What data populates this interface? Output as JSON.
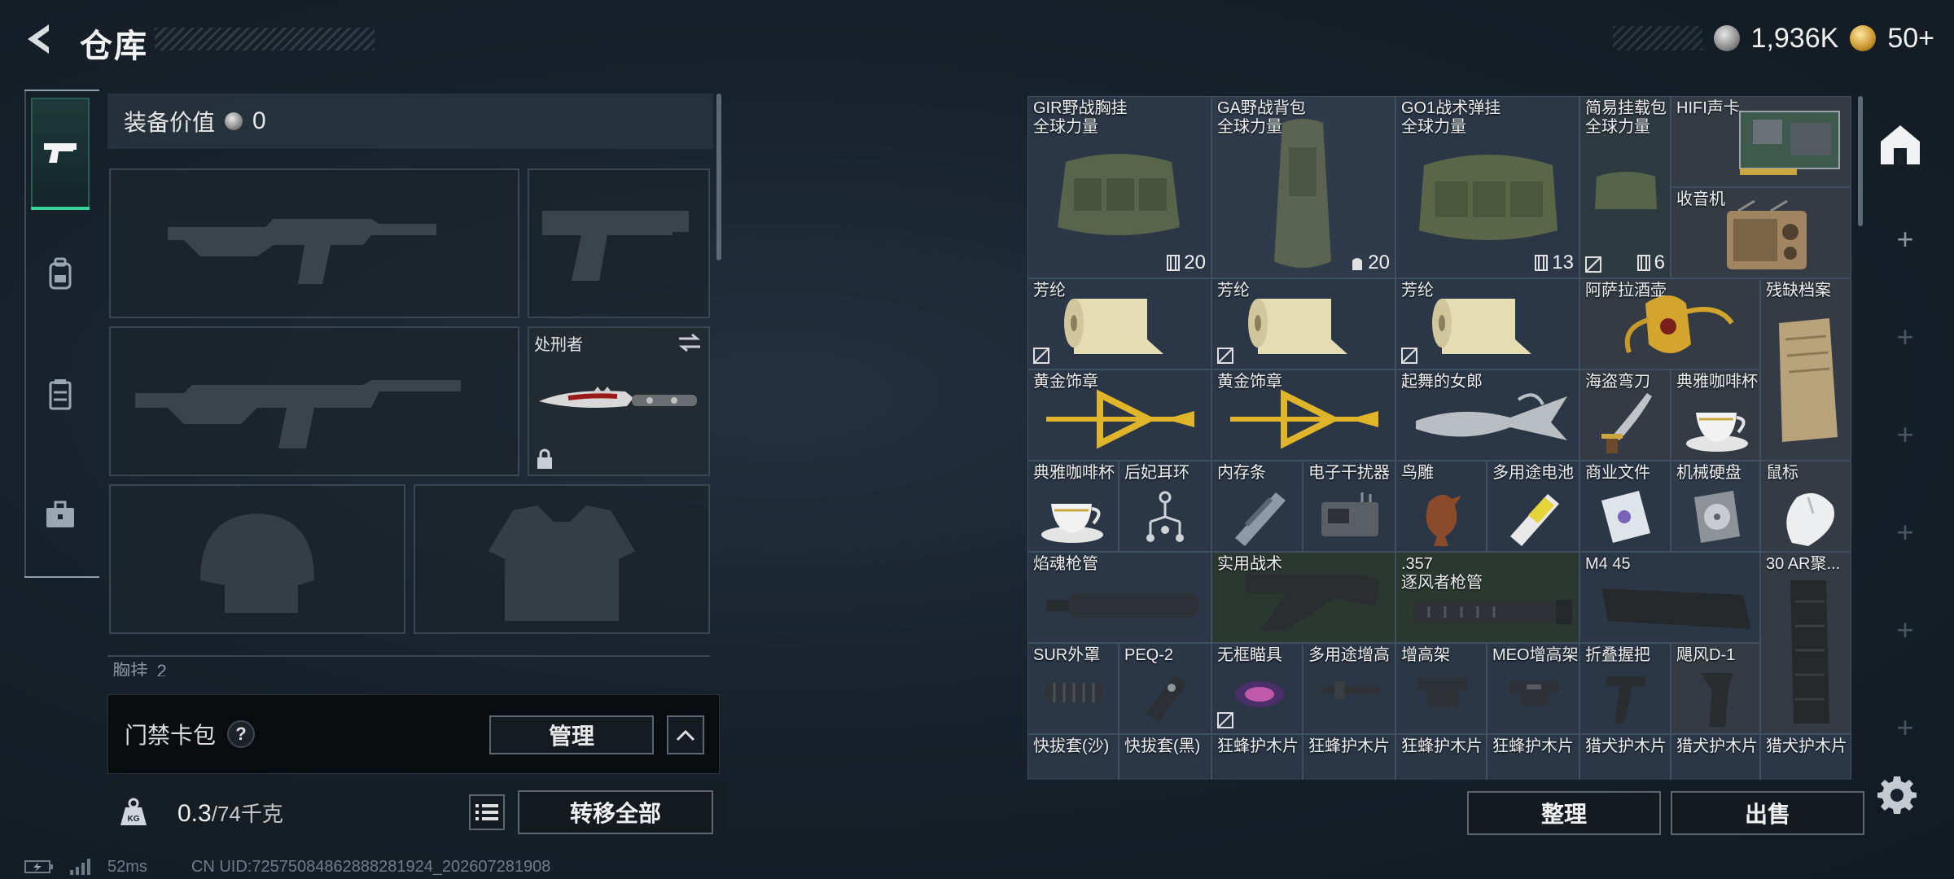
{
  "header": {
    "title": "仓库",
    "currencies": [
      {
        "icon": "silver-coin-icon",
        "value": "1,936K"
      },
      {
        "icon": "gold-coin-icon",
        "value": "50+"
      }
    ]
  },
  "rail": {
    "tabs": [
      {
        "icon": "pistol-icon",
        "active": true
      },
      {
        "icon": "backpack-icon",
        "active": false
      },
      {
        "icon": "vest-icon",
        "active": false
      },
      {
        "icon": "briefcase-icon",
        "active": false
      }
    ]
  },
  "equipment": {
    "value_label": "装备价值",
    "value": "0",
    "knife_slot_title": "处刑者",
    "chest_label": "胸挂",
    "chest_count": "2"
  },
  "access_card": {
    "label": "门禁卡包",
    "help": "?",
    "manage_label": "管理"
  },
  "weight": {
    "current": "0.3",
    "capacity": "/74千克",
    "transfer_all_label": "转移全部"
  },
  "footer": {
    "ping": "52ms",
    "uid": "CN UID:7257508486288828​1924_202607281908"
  },
  "warehouse": {
    "items": [
      {
        "name": "GIR野战胸挂",
        "sub": "全球力量",
        "count": "20"
      },
      {
        "name": "GA野战背包",
        "sub": "全球力量",
        "count": "20"
      },
      {
        "name": "GO1战术弹挂",
        "sub": "全球力量",
        "count": "13"
      },
      {
        "name": "简易挂载包",
        "sub": "全球力量",
        "count": "6"
      },
      {
        "name": "HIFI声卡"
      },
      {
        "name": "收音机"
      },
      {
        "name": "芳纶"
      },
      {
        "name": "芳纶"
      },
      {
        "name": "芳纶"
      },
      {
        "name": "阿萨拉酒壶"
      },
      {
        "name": "残缺档案"
      },
      {
        "name": "黄金饰章"
      },
      {
        "name": "黄金饰章"
      },
      {
        "name": "起舞的女郎"
      },
      {
        "name": "海盗弯刀"
      },
      {
        "name": "典雅咖啡杯"
      },
      {
        "name": "典雅咖啡杯"
      },
      {
        "name": "后妃耳环"
      },
      {
        "name": "内存条"
      },
      {
        "name": "电子干扰器"
      },
      {
        "name": "鸟雕"
      },
      {
        "name": "多用途电池"
      },
      {
        "name": "商业文件"
      },
      {
        "name": "机械硬盘"
      },
      {
        "name": "鼠标"
      },
      {
        "name": "焰魂枪管"
      },
      {
        "name": "实用战术"
      },
      {
        "name": ".357",
        "sub": "逐风者枪管"
      },
      {
        "name": "M4 45"
      },
      {
        "name": "30 AR聚..."
      },
      {
        "name": "SUR外罩"
      },
      {
        "name": "PEQ-2"
      },
      {
        "name": "无框瞄具"
      },
      {
        "name": "多用途增高"
      },
      {
        "name": "增高架"
      },
      {
        "name": "MEO增高架"
      },
      {
        "name": "折叠握把"
      },
      {
        "name": "飓风D-1"
      },
      {
        "name": "快拔套(沙)"
      },
      {
        "name": "快拔套(黑)"
      },
      {
        "name": "狂蜂护木片"
      },
      {
        "name": "狂蜂护木片"
      },
      {
        "name": "狂蜂护木片"
      },
      {
        "name": "狂蜂护木片"
      },
      {
        "name": "猎犬护木片"
      },
      {
        "name": "猎犬护木片"
      },
      {
        "name": "猎犬护木片"
      }
    ]
  },
  "actions": {
    "sort_label": "整理",
    "sell_label": "出售"
  },
  "colors": {
    "accent_green": "#37d39b",
    "panel_bg": "#2b3746",
    "button_border": "#5b6670"
  }
}
